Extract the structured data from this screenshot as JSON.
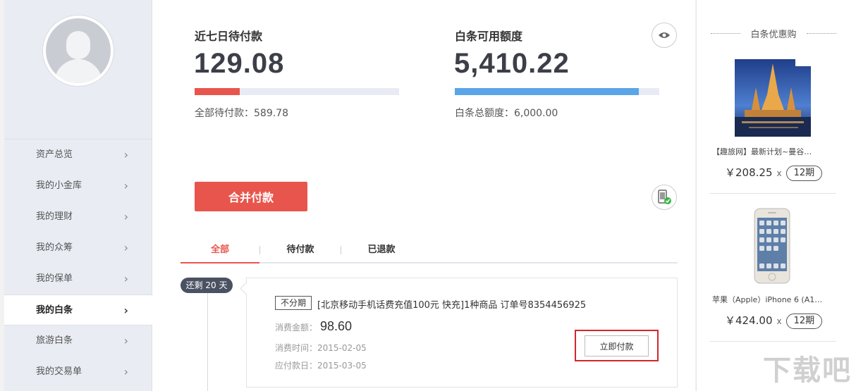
{
  "sidebar": {
    "menu": [
      {
        "label": "资产总览"
      },
      {
        "label": "我的小金库"
      },
      {
        "label": "我的理财"
      },
      {
        "label": "我的众筹"
      },
      {
        "label": "我的保单"
      },
      {
        "label": "我的白条",
        "active": true
      },
      {
        "label": "旅游白条"
      },
      {
        "label": "我的交易单"
      }
    ]
  },
  "summary": {
    "due7": {
      "title": "近七日待付款",
      "value": "129.08",
      "sub_label": "全部待付款：",
      "sub_value": "589.78",
      "progress": 0.22,
      "color": "#e8554c"
    },
    "available": {
      "title": "白条可用额度",
      "value": "5,410.22",
      "sub_label": "白条总额度：",
      "sub_value": "6,000.00",
      "progress": 0.9,
      "color": "#5aa5e8"
    }
  },
  "actions": {
    "merge_pay": "合并付款"
  },
  "tabs": [
    {
      "label": "全部",
      "active": true
    },
    {
      "label": "待付款"
    },
    {
      "label": "已退款"
    }
  ],
  "order": {
    "days_left": "还剩 20 天",
    "tag": "不分期",
    "title": "[北京移动手机话费充值100元 快充]1种商品 订单号8354456925",
    "amount_label": "消费金额：",
    "amount": "98.60",
    "time_label": "消费时间：",
    "time": "2015-02-05",
    "due_label": "应付款日：",
    "due": "2015-03-05",
    "pay_button": "立即付款"
  },
  "promo": {
    "title": "白条优惠购",
    "products": [
      {
        "name": "【趣旅网】最新计划~曼谷…",
        "price": "￥208.25",
        "x": "x",
        "period": "12期"
      },
      {
        "name": "苹果（Apple）iPhone 6 (A1…",
        "price": "￥424.00",
        "x": "x",
        "period": "12期"
      }
    ]
  },
  "watermark": "下载吧",
  "icons": {
    "eye": "eye-icon",
    "phone_check": "phone-check-icon"
  }
}
